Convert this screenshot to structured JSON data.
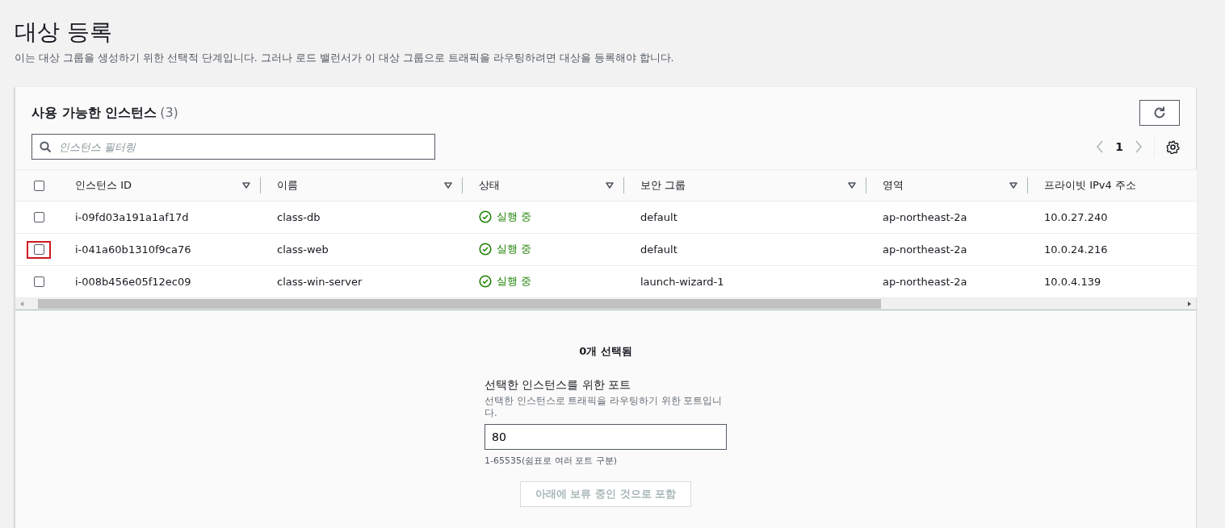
{
  "page": {
    "title": "대상 등록",
    "description": "이는 대상 그룹을 생성하기 위한 선택적 단계입니다. 그러나 로드 밸런서가 이 대상 그룹으로 트래픽을 라우팅하려면 대상을 등록해야 합니다."
  },
  "instances": {
    "title": "사용 가능한 인스턴스",
    "count": "(3)",
    "filter": {
      "placeholder": "인스턴스 필터링"
    },
    "page_number": "1",
    "columns": [
      "인스턴스 ID",
      "이름",
      "상태",
      "보안 그룹",
      "영역",
      "프라이빗 IPv4 주소"
    ],
    "all_checked": false,
    "rows": [
      {
        "checked": false,
        "highlighted": false,
        "cells": [
          "i-09fd03a191a1af17d",
          "class-db",
          "실행 중",
          "default",
          "ap-northeast-2a",
          "10.0.27.240"
        ]
      },
      {
        "checked": false,
        "highlighted": true,
        "cells": [
          "i-041a60b1310f9ca76",
          "class-web",
          "실행 중",
          "default",
          "ap-northeast-2a",
          "10.0.24.216"
        ]
      },
      {
        "checked": false,
        "highlighted": false,
        "cells": [
          "i-008b456e05f12ec09",
          "class-win-server",
          "실행 중",
          "launch-wizard-1",
          "ap-northeast-2a",
          "10.0.4.139"
        ]
      }
    ]
  },
  "selection": {
    "summary": "0개 선택됨",
    "port_label": "선택한 인스턴스를 위한 포트",
    "port_hint": "선택한 인스턴스로 트래픽을 라우팅하기 위한 포트입니다.",
    "port_value": "80",
    "port_range": "1-65535(쉼표로 여러 포트 구분)",
    "include_button": {
      "label": "아래에 보류 중인 것으로 포함",
      "disabled": true
    }
  }
}
